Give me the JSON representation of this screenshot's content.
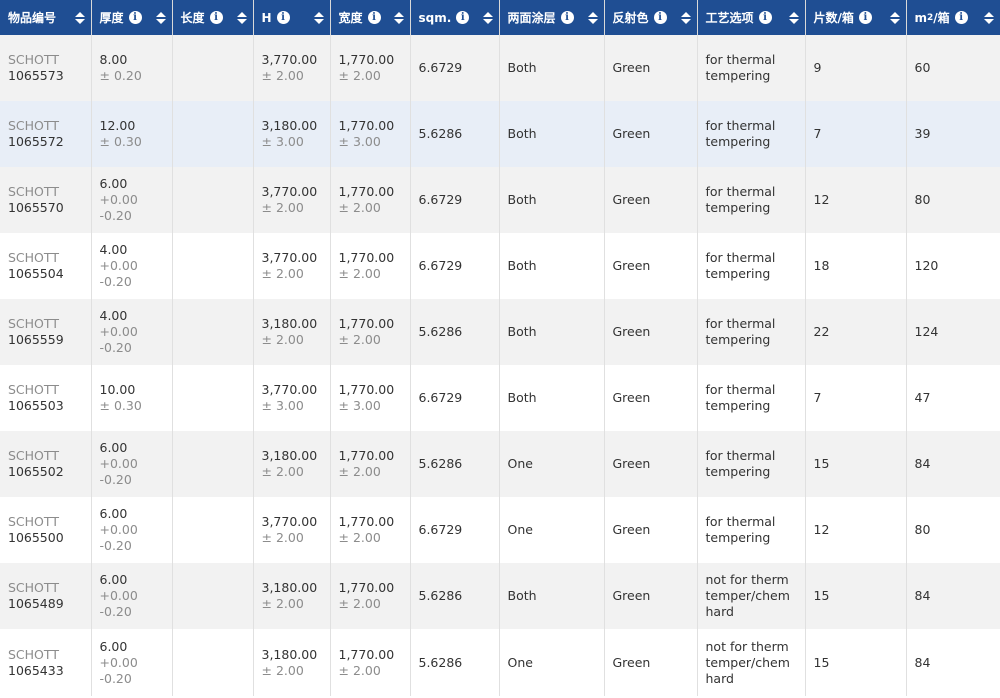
{
  "header": {
    "columns": [
      {
        "label": "物品编号",
        "info": false
      },
      {
        "label": "厚度",
        "info": true
      },
      {
        "label": "长度",
        "info": true
      },
      {
        "label": "H",
        "info": true
      },
      {
        "label": "宽度",
        "info": true
      },
      {
        "label": "sqm.",
        "info": true
      },
      {
        "label": "两面涂层",
        "info": true
      },
      {
        "label": "反射色",
        "info": true
      },
      {
        "label": "工艺选项",
        "info": true
      },
      {
        "label": "片数/箱",
        "info": true
      },
      {
        "label": "m",
        "sup": "2",
        "suffix": "/箱",
        "info": true
      }
    ],
    "info_glyph": "i"
  },
  "rows": [
    {
      "brand": "SCHOTT",
      "id": "1065573",
      "thk": "8.00",
      "thk_tol": [
        "± 0.20"
      ],
      "len": "",
      "h": "3,770.00",
      "h_tol": "± 2.00",
      "w": "1,770.00",
      "w_tol": "± 2.00",
      "sqm": "6.6729",
      "coat": "Both",
      "color": "Green",
      "process": [
        "for thermal",
        "tempering"
      ],
      "pcs": "9",
      "m2": "60"
    },
    {
      "brand": "SCHOTT",
      "id": "1065572",
      "thk": "12.00",
      "thk_tol": [
        "± 0.30"
      ],
      "len": "",
      "h": "3,180.00",
      "h_tol": "± 3.00",
      "w": "1,770.00",
      "w_tol": "± 3.00",
      "sqm": "5.6286",
      "coat": "Both",
      "color": "Green",
      "process": [
        "for thermal",
        "tempering"
      ],
      "pcs": "7",
      "m2": "39"
    },
    {
      "brand": "SCHOTT",
      "id": "1065570",
      "thk": "6.00",
      "thk_tol": [
        "+0.00",
        "-0.20"
      ],
      "len": "",
      "h": "3,770.00",
      "h_tol": "± 2.00",
      "w": "1,770.00",
      "w_tol": "± 2.00",
      "sqm": "6.6729",
      "coat": "Both",
      "color": "Green",
      "process": [
        "for thermal",
        "tempering"
      ],
      "pcs": "12",
      "m2": "80"
    },
    {
      "brand": "SCHOTT",
      "id": "1065504",
      "thk": "4.00",
      "thk_tol": [
        "+0.00",
        "-0.20"
      ],
      "len": "",
      "h": "3,770.00",
      "h_tol": "± 2.00",
      "w": "1,770.00",
      "w_tol": "± 2.00",
      "sqm": "6.6729",
      "coat": "Both",
      "color": "Green",
      "process": [
        "for thermal",
        "tempering"
      ],
      "pcs": "18",
      "m2": "120"
    },
    {
      "brand": "SCHOTT",
      "id": "1065559",
      "thk": "4.00",
      "thk_tol": [
        "+0.00",
        "-0.20"
      ],
      "len": "",
      "h": "3,180.00",
      "h_tol": "± 2.00",
      "w": "1,770.00",
      "w_tol": "± 2.00",
      "sqm": "5.6286",
      "coat": "Both",
      "color": "Green",
      "process": [
        "for thermal",
        "tempering"
      ],
      "pcs": "22",
      "m2": "124"
    },
    {
      "brand": "SCHOTT",
      "id": "1065503",
      "thk": "10.00",
      "thk_tol": [
        "± 0.30"
      ],
      "len": "",
      "h": "3,770.00",
      "h_tol": "± 3.00",
      "w": "1,770.00",
      "w_tol": "± 3.00",
      "sqm": "6.6729",
      "coat": "Both",
      "color": "Green",
      "process": [
        "for thermal",
        "tempering"
      ],
      "pcs": "7",
      "m2": "47"
    },
    {
      "brand": "SCHOTT",
      "id": "1065502",
      "thk": "6.00",
      "thk_tol": [
        "+0.00",
        "-0.20"
      ],
      "len": "",
      "h": "3,180.00",
      "h_tol": "± 2.00",
      "w": "1,770.00",
      "w_tol": "± 2.00",
      "sqm": "5.6286",
      "coat": "One",
      "color": "Green",
      "process": [
        "for thermal",
        "tempering"
      ],
      "pcs": "15",
      "m2": "84"
    },
    {
      "brand": "SCHOTT",
      "id": "1065500",
      "thk": "6.00",
      "thk_tol": [
        "+0.00",
        "-0.20"
      ],
      "len": "",
      "h": "3,770.00",
      "h_tol": "± 2.00",
      "w": "1,770.00",
      "w_tol": "± 2.00",
      "sqm": "6.6729",
      "coat": "One",
      "color": "Green",
      "process": [
        "for thermal",
        "tempering"
      ],
      "pcs": "12",
      "m2": "80"
    },
    {
      "brand": "SCHOTT",
      "id": "1065489",
      "thk": "6.00",
      "thk_tol": [
        "+0.00",
        "-0.20"
      ],
      "len": "",
      "h": "3,180.00",
      "h_tol": "± 2.00",
      "w": "1,770.00",
      "w_tol": "± 2.00",
      "sqm": "5.6286",
      "coat": "Both",
      "color": "Green",
      "process": [
        "not for therm",
        "temper/chem",
        "hard"
      ],
      "pcs": "15",
      "m2": "84"
    },
    {
      "brand": "SCHOTT",
      "id": "1065433",
      "thk": "6.00",
      "thk_tol": [
        "+0.00",
        "-0.20"
      ],
      "len": "",
      "h": "3,180.00",
      "h_tol": "± 2.00",
      "w": "1,770.00",
      "w_tol": "± 2.00",
      "sqm": "5.6286",
      "coat": "One",
      "color": "Green",
      "process": [
        "not for therm",
        "temper/chem",
        "hard"
      ],
      "pcs": "15",
      "m2": "84"
    }
  ],
  "colors": {
    "header_bg": "#1f4e93",
    "row_alt": "#f2f2f2",
    "row_highlight": "#e8eef7"
  }
}
